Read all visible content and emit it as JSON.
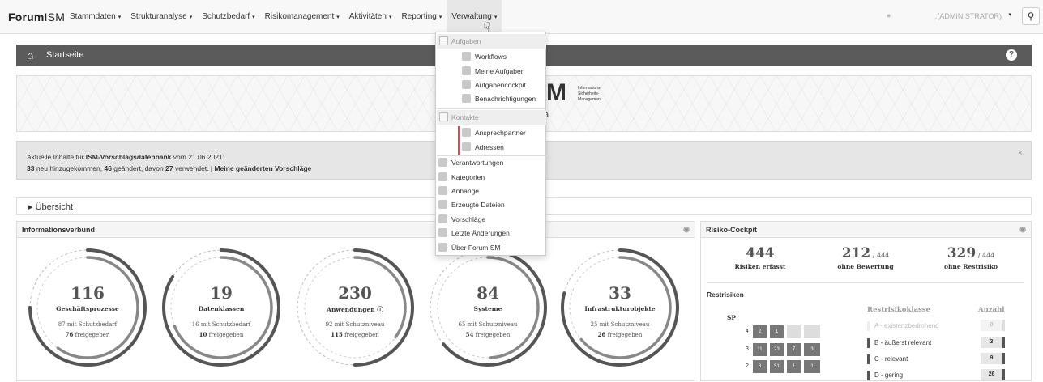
{
  "navbar": {
    "brand_a": "Forum",
    "brand_b": "ISM",
    "items": [
      {
        "label": "Stammdaten"
      },
      {
        "label": "Strukturanalyse"
      },
      {
        "label": "Schutzbedarf"
      },
      {
        "label": "Risikomanagement"
      },
      {
        "label": "Aktivitäten"
      },
      {
        "label": "Reporting"
      },
      {
        "label": "Verwaltung"
      }
    ],
    "caret": "▾",
    "user": ":(ADMINISTRATOR)",
    "search_icon": "magnifier-icon"
  },
  "home": {
    "title": "Startseite",
    "help": "?"
  },
  "banner": {
    "logo_letter": "M",
    "logo_text": "Informations-\nSicherheits-\nManagement",
    "sub": "a"
  },
  "info": {
    "line1_prefix": "Aktuelle Inhalte für ",
    "line1_db": "ISM-Vorschlagsdatenbank",
    "line1_suffix": " vom 21.06.2021:",
    "new_count": "33",
    "new_text": " neu hinzugekommen, ",
    "changed_count": "46",
    "changed_text": " geändert, davon ",
    "used_count": "27",
    "used_text": " verwendet. | ",
    "link": "Meine geänderten Vorschläge",
    "close": "×"
  },
  "overview": {
    "label": "▸  Übersicht"
  },
  "informationsverbund": {
    "title": "Informationsverbund",
    "cards": [
      {
        "num": "116",
        "label": "Geschäftsprozesse",
        "s1": "87 mit Schutzbedarf",
        "s2n": "76",
        "s2": " freigegeben",
        "fill": 0.75
      },
      {
        "num": "19",
        "label": "Datenklassen",
        "s1": "16 mit Schutzbedarf",
        "s2n": "10",
        "s2": " freigegeben",
        "fill": 0.84
      },
      {
        "num": "230",
        "label": "Anwendungen ⓘ",
        "s1": "92 mit Schutzniveau",
        "s2n": "115",
        "s2": " freigegeben",
        "fill": 0.5
      },
      {
        "num": "84",
        "label": "Systeme",
        "s1": "65 mit Schutzniveau",
        "s2n": "54",
        "s2": " freigegeben",
        "fill": 0.64
      },
      {
        "num": "33",
        "label": "Infrastrukturobjekte",
        "s1": "25 mit Schutzniveau",
        "s2n": "26",
        "s2": " freigegeben",
        "fill": 0.79
      }
    ]
  },
  "risiko": {
    "title": "Risiko-Cockpit",
    "stats": [
      {
        "n": "444",
        "of": "",
        "t": "Risiken erfasst"
      },
      {
        "n": "212",
        "of": " / 444",
        "t": "ohne Bewertung"
      },
      {
        "n": "329",
        "of": " / 444",
        "t": "ohne Restrisiko"
      }
    ],
    "restrisiken": "Restrisiken",
    "sp": "SP",
    "matrix_rows": [
      {
        "label": "4",
        "cells": [
          "2",
          "1",
          "",
          ""
        ]
      },
      {
        "label": "3",
        "cells": [
          "11",
          "23",
          "7",
          "3"
        ]
      },
      {
        "label": "2",
        "cells": [
          "8",
          "51",
          "1",
          "1"
        ]
      }
    ],
    "class_head": "Restrisikoklasse",
    "count_head": "Anzahl",
    "classes": [
      {
        "label": "A - existenzbedrohend",
        "count": "0"
      },
      {
        "label": "B - äußerst relevant",
        "count": "3"
      },
      {
        "label": "C - relevant",
        "count": "9"
      },
      {
        "label": "D - gering",
        "count": "26"
      }
    ]
  },
  "dropdown": {
    "aufgaben": "Aufgaben",
    "workflows": "Workflows",
    "meine": "Meine Aufgaben",
    "cockpit": "Aufgabencockpit",
    "benach": "Benachrichtigungen",
    "kontakte": "Kontakte",
    "ansprech": "Ansprechpartner",
    "adressen": "Adressen",
    "verant": "Verantwortungen",
    "kategorien": "Kategorien",
    "anhaenge": "Anhänge",
    "dateien": "Erzeugte Dateien",
    "vorschlaege": "Vorschläge",
    "aenderungen": "Letzte Änderungen",
    "ueber": "Über ForumISM"
  }
}
